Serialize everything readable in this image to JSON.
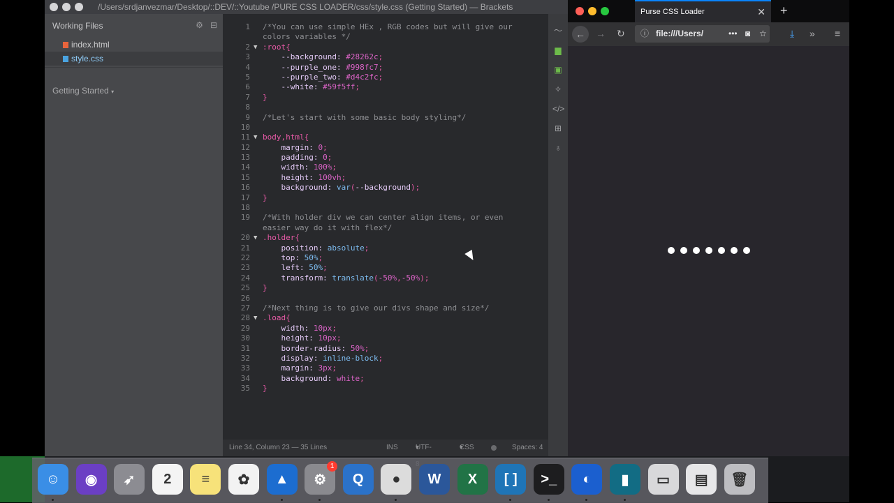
{
  "brackets": {
    "title": "/Users/srdjanvezmar/Desktop/::DEV/::Youtube /PURE CSS LOADER/css/style.css (Getting Started) — Brackets",
    "working_files_label": "Working Files",
    "files": [
      {
        "name": "index.html",
        "icon_color": "#e8643c",
        "active": false
      },
      {
        "name": "style.css",
        "icon_color": "#4aa3e0",
        "active": true
      }
    ],
    "project_label": "Getting Started",
    "status": {
      "position": "Line 34, Column 23 — 35 Lines",
      "mode": "INS",
      "encoding": "UTF-8",
      "language": "CSS",
      "spaces": "Spaces: 4"
    },
    "code_lines": [
      {
        "n": "1",
        "fold": "",
        "parts": [
          {
            "c": "c-com",
            "t": "/*You can use simple HEx , RGB codes but will give our"
          }
        ]
      },
      {
        "n": "",
        "fold": "",
        "parts": [
          {
            "c": "c-com",
            "t": "colors variables */"
          }
        ]
      },
      {
        "n": "2",
        "fold": "▼",
        "parts": [
          {
            "c": "c-sel",
            "t": ":root{"
          }
        ]
      },
      {
        "n": "3",
        "fold": "",
        "parts": [
          {
            "c": "c-prop",
            "t": "    --background: "
          },
          {
            "c": "c-val",
            "t": "#28262c"
          },
          {
            "c": "c-p",
            "t": ";"
          }
        ]
      },
      {
        "n": "4",
        "fold": "",
        "parts": [
          {
            "c": "c-prop",
            "t": "    --purple_one: "
          },
          {
            "c": "c-val",
            "t": "#998fc7"
          },
          {
            "c": "c-p",
            "t": ";"
          }
        ]
      },
      {
        "n": "5",
        "fold": "",
        "parts": [
          {
            "c": "c-prop",
            "t": "    --purple_two: "
          },
          {
            "c": "c-val",
            "t": "#d4c2fc"
          },
          {
            "c": "c-p",
            "t": ";"
          }
        ]
      },
      {
        "n": "6",
        "fold": "",
        "parts": [
          {
            "c": "c-prop",
            "t": "    --white: "
          },
          {
            "c": "c-val",
            "t": "#59f5ff"
          },
          {
            "c": "c-p",
            "t": ";"
          }
        ]
      },
      {
        "n": "7",
        "fold": "",
        "parts": [
          {
            "c": "c-sel",
            "t": "}"
          }
        ]
      },
      {
        "n": "8",
        "fold": "",
        "parts": []
      },
      {
        "n": "9",
        "fold": "",
        "parts": [
          {
            "c": "c-com",
            "t": "/*Let's start with some basic body styling*/"
          }
        ]
      },
      {
        "n": "10",
        "fold": "",
        "parts": []
      },
      {
        "n": "11",
        "fold": "▼",
        "parts": [
          {
            "c": "c-sel",
            "t": "body,html{"
          }
        ]
      },
      {
        "n": "12",
        "fold": "",
        "parts": [
          {
            "c": "c-prop",
            "t": "    margin: "
          },
          {
            "c": "c-val",
            "t": "0"
          },
          {
            "c": "c-p",
            "t": ";"
          }
        ]
      },
      {
        "n": "13",
        "fold": "",
        "parts": [
          {
            "c": "c-prop",
            "t": "    padding: "
          },
          {
            "c": "c-val",
            "t": "0"
          },
          {
            "c": "c-p",
            "t": ";"
          }
        ]
      },
      {
        "n": "14",
        "fold": "",
        "parts": [
          {
            "c": "c-prop",
            "t": "    width: "
          },
          {
            "c": "c-val",
            "t": "100%"
          },
          {
            "c": "c-p",
            "t": ";"
          }
        ]
      },
      {
        "n": "15",
        "fold": "",
        "parts": [
          {
            "c": "c-prop",
            "t": "    height: "
          },
          {
            "c": "c-val",
            "t": "100vh"
          },
          {
            "c": "c-p",
            "t": ";"
          }
        ]
      },
      {
        "n": "16",
        "fold": "",
        "parts": [
          {
            "c": "c-prop",
            "t": "    background: "
          },
          {
            "c": "c-fn",
            "t": "var"
          },
          {
            "c": "c-p",
            "t": "("
          },
          {
            "c": "c-prop",
            "t": "--background"
          },
          {
            "c": "c-p",
            "t": ");"
          }
        ]
      },
      {
        "n": "17",
        "fold": "",
        "parts": [
          {
            "c": "c-sel",
            "t": "}"
          }
        ]
      },
      {
        "n": "18",
        "fold": "",
        "parts": []
      },
      {
        "n": "19",
        "fold": "",
        "parts": [
          {
            "c": "c-com",
            "t": "/*With holder div we can center align items, or even"
          }
        ]
      },
      {
        "n": "",
        "fold": "",
        "parts": [
          {
            "c": "c-com",
            "t": "easier way do it with flex*/"
          }
        ]
      },
      {
        "n": "20",
        "fold": "▼",
        "parts": [
          {
            "c": "c-sel",
            "t": ".holder{"
          }
        ]
      },
      {
        "n": "21",
        "fold": "",
        "parts": [
          {
            "c": "c-prop",
            "t": "    position: "
          },
          {
            "c": "c-fn",
            "t": "absolute"
          },
          {
            "c": "c-p",
            "t": ";"
          }
        ]
      },
      {
        "n": "22",
        "fold": "",
        "parts": [
          {
            "c": "c-prop",
            "t": "    top: "
          },
          {
            "c": "c-fn",
            "t": "50%"
          },
          {
            "c": "c-p",
            "t": ";"
          }
        ]
      },
      {
        "n": "23",
        "fold": "",
        "parts": [
          {
            "c": "c-prop",
            "t": "    left: "
          },
          {
            "c": "c-fn",
            "t": "50%"
          },
          {
            "c": "c-p",
            "t": ";"
          }
        ]
      },
      {
        "n": "24",
        "fold": "",
        "parts": [
          {
            "c": "c-prop",
            "t": "    transform: "
          },
          {
            "c": "c-fn",
            "t": "translate"
          },
          {
            "c": "c-p",
            "t": "("
          },
          {
            "c": "c-val",
            "t": "-50%"
          },
          {
            "c": "c-p",
            "t": ","
          },
          {
            "c": "c-val",
            "t": "-50%"
          },
          {
            "c": "c-p",
            "t": ");"
          }
        ]
      },
      {
        "n": "25",
        "fold": "",
        "parts": [
          {
            "c": "c-sel",
            "t": "}"
          }
        ]
      },
      {
        "n": "26",
        "fold": "",
        "parts": []
      },
      {
        "n": "27",
        "fold": "",
        "parts": [
          {
            "c": "c-com",
            "t": "/*Next thing is to give our divs shape and size*/"
          }
        ]
      },
      {
        "n": "28",
        "fold": "▼",
        "parts": [
          {
            "c": "c-sel",
            "t": ".load{"
          }
        ]
      },
      {
        "n": "29",
        "fold": "",
        "parts": [
          {
            "c": "c-prop",
            "t": "    width: "
          },
          {
            "c": "c-val",
            "t": "10px"
          },
          {
            "c": "c-p",
            "t": ";"
          }
        ]
      },
      {
        "n": "30",
        "fold": "",
        "parts": [
          {
            "c": "c-prop",
            "t": "    height: "
          },
          {
            "c": "c-val",
            "t": "10px"
          },
          {
            "c": "c-p",
            "t": ";"
          }
        ]
      },
      {
        "n": "31",
        "fold": "",
        "parts": [
          {
            "c": "c-prop",
            "t": "    border-radius: "
          },
          {
            "c": "c-val",
            "t": "50%"
          },
          {
            "c": "c-p",
            "t": ";"
          }
        ]
      },
      {
        "n": "32",
        "fold": "",
        "parts": [
          {
            "c": "c-prop",
            "t": "    display: "
          },
          {
            "c": "c-fn",
            "t": "inline-block"
          },
          {
            "c": "c-p",
            "t": ";"
          }
        ]
      },
      {
        "n": "33",
        "fold": "",
        "parts": [
          {
            "c": "c-prop",
            "t": "    margin: "
          },
          {
            "c": "c-val",
            "t": "3px"
          },
          {
            "c": "c-p",
            "t": ";"
          }
        ]
      },
      {
        "n": "34",
        "fold": "",
        "parts": [
          {
            "c": "c-prop",
            "t": "    background: "
          },
          {
            "c": "c-val",
            "t": "white"
          },
          {
            "c": "c-p",
            "t": ";"
          }
        ]
      },
      {
        "n": "35",
        "fold": "",
        "parts": [
          {
            "c": "c-sel",
            "t": "}"
          }
        ]
      }
    ]
  },
  "firefox": {
    "tab_title": "Purse CSS Loader",
    "url": "file:///Users/",
    "loader_dot_count": 7
  },
  "dock": {
    "apps": [
      {
        "name": "finder",
        "color": "#3a8ee6",
        "glyph": "☺",
        "running": true
      },
      {
        "name": "siri",
        "color": "#6b3fc4",
        "glyph": "◉",
        "running": false
      },
      {
        "name": "launchpad",
        "color": "#8c8c92",
        "glyph": "➶",
        "running": false
      },
      {
        "name": "calendar",
        "color": "#f4f4f4",
        "glyph": "2",
        "running": false,
        "dark": true
      },
      {
        "name": "notes",
        "color": "#f7e27a",
        "glyph": "≡",
        "running": false,
        "dark": true
      },
      {
        "name": "photos",
        "color": "#f2f2f2",
        "glyph": "✿",
        "running": false,
        "dark": true
      },
      {
        "name": "affinity",
        "color": "#1c6dd0",
        "glyph": "▲",
        "running": true
      },
      {
        "name": "system-preferences",
        "color": "#8a8a8f",
        "glyph": "⚙",
        "running": true,
        "badge": "1"
      },
      {
        "name": "quicktime",
        "color": "#2b72c9",
        "glyph": "Q",
        "running": false
      },
      {
        "name": "sequel-pro",
        "color": "#dcdcdc",
        "glyph": "●",
        "running": true,
        "dark": true
      },
      {
        "name": "word",
        "color": "#2b579a",
        "glyph": "W",
        "running": false
      },
      {
        "name": "excel",
        "color": "#217346",
        "glyph": "X",
        "running": false
      },
      {
        "name": "brackets",
        "color": "#1f75b7",
        "glyph": "[ ]",
        "running": true
      },
      {
        "name": "terminal",
        "color": "#1d1d1f",
        "glyph": ">_",
        "running": true
      },
      {
        "name": "firefox",
        "color": "#1b5fcf",
        "glyph": "◐",
        "running": true
      },
      {
        "name": "book",
        "color": "#126c84",
        "glyph": "▮",
        "running": true
      },
      {
        "name": "folder",
        "color": "#d8d8da",
        "glyph": "▭",
        "running": false,
        "dark": true
      },
      {
        "name": "document",
        "color": "#e6e6e8",
        "glyph": "▤",
        "running": false,
        "dark": true
      },
      {
        "name": "trash",
        "color": "#bdbdc1",
        "glyph": "🗑",
        "running": false,
        "dark": true
      }
    ]
  }
}
